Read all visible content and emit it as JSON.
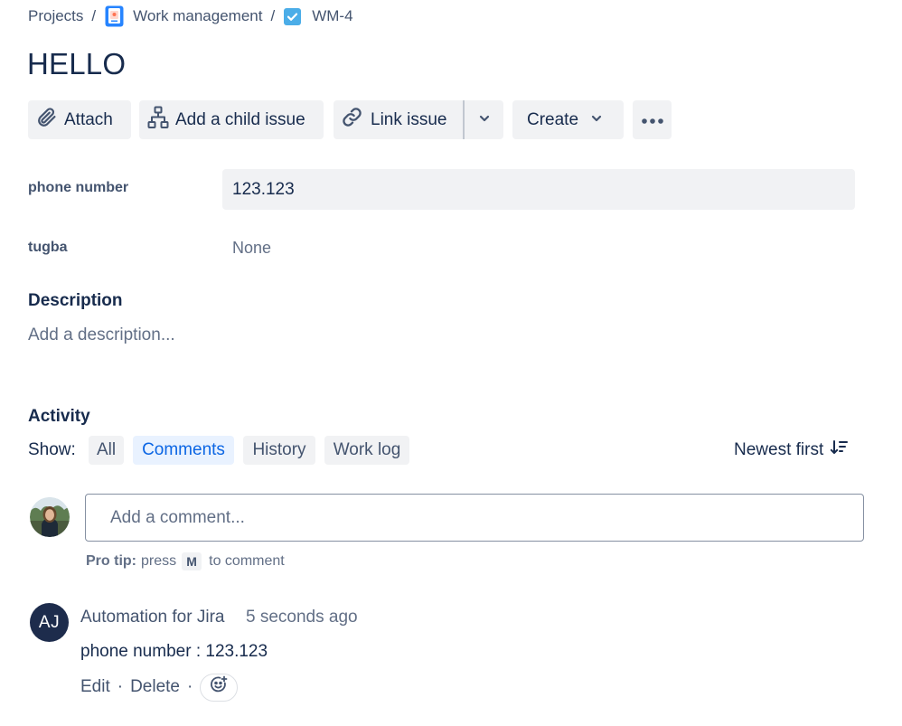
{
  "breadcrumb": {
    "projects": "Projects",
    "project_name": "Work management",
    "issue_key": "WM-4",
    "separator": "/"
  },
  "issue": {
    "title": "HELLO"
  },
  "toolbar": {
    "attach_label": "Attach",
    "add_child_label": "Add a child issue",
    "link_issue_label": "Link issue",
    "create_label": "Create"
  },
  "fields": {
    "phone": {
      "label": "phone number",
      "value": "123.123"
    },
    "tugba": {
      "label": "tugba",
      "value": "None"
    }
  },
  "description": {
    "heading": "Description",
    "placeholder": "Add a description..."
  },
  "activity": {
    "heading": "Activity",
    "show_label": "Show:",
    "tabs": [
      {
        "label": "All",
        "active": false
      },
      {
        "label": "Comments",
        "active": true
      },
      {
        "label": "History",
        "active": false
      },
      {
        "label": "Work log",
        "active": false
      }
    ],
    "sort_label": "Newest first"
  },
  "composer": {
    "placeholder": "Add a comment...",
    "protip_bold": "Pro tip:",
    "protip_press": "press",
    "protip_key": "M",
    "protip_rest": "to comment"
  },
  "comment": {
    "avatar_initials": "AJ",
    "author": "Automation for Jira",
    "timestamp": "5 seconds ago",
    "body": "phone number : 123.123",
    "edit_label": "Edit",
    "delete_label": "Delete",
    "separator": "·"
  },
  "icons": {
    "attach": "paperclip-icon",
    "child_issue": "hierarchy-icon",
    "link": "link-icon",
    "more": "more-icon",
    "sort": "sort-descending-icon",
    "reaction": "add-reaction-icon"
  },
  "colors": {
    "text_primary": "#172b4d",
    "text_subtle": "#44546f",
    "button_bg": "#f1f2f4",
    "active_tab_bg": "#e9f2ff",
    "active_tab_text": "#0c66e4",
    "task_icon": "#4bade8",
    "avatar_bg": "#1d2c4c"
  }
}
